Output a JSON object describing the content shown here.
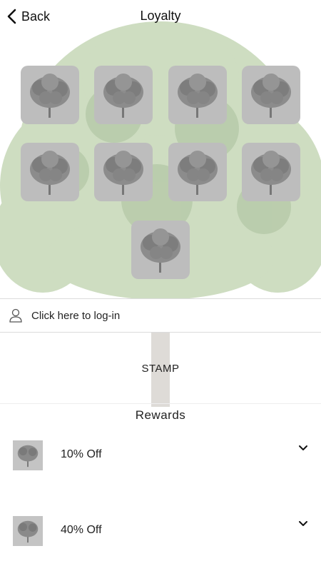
{
  "header": {
    "back_label": "Back",
    "title": "Loyalty"
  },
  "stamps": {
    "count": 9,
    "icon": "tree-icon",
    "collected": 0
  },
  "login": {
    "text": "Click here to log-in",
    "icon": "user-icon"
  },
  "stamp_button": {
    "label": "STAMP"
  },
  "rewards": {
    "heading": "Rewards",
    "items": [
      {
        "label": "10% Off",
        "icon": "tree-icon"
      },
      {
        "label": "40% Off",
        "icon": "tree-icon"
      }
    ]
  },
  "colors": {
    "stamp_bg": "#bdbdbd",
    "background": "#ffffff",
    "tree_green": "#5e8f3a"
  }
}
